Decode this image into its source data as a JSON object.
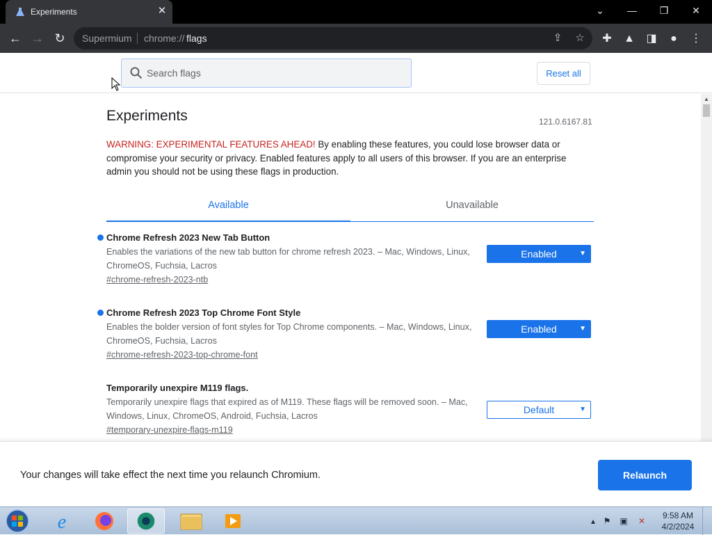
{
  "browser": {
    "tab_title": "Experiments",
    "tab_close": "✕",
    "window_controls": {
      "dropdown": "⌄",
      "minimize": "—",
      "restore": "❐",
      "close": "✕"
    },
    "omnibox": {
      "scheme_label": "Supermium",
      "url_prefix": "chrome://",
      "url_path": "flags"
    }
  },
  "flags_header": {
    "search_placeholder": "Search flags",
    "reset_all_label": "Reset all"
  },
  "page": {
    "title": "Experiments",
    "version": "121.0.6167.81",
    "warning_prefix": "WARNING: EXPERIMENTAL FEATURES AHEAD!",
    "warning_text": " By enabling these features, you could lose browser data or compromise your security or privacy. Enabled features apply to all users of this browser. If you are an enterprise admin you should not be using these flags in production.",
    "tabs": [
      {
        "label": "Available",
        "selected": true
      },
      {
        "label": "Unavailable",
        "selected": false
      }
    ],
    "flags": [
      {
        "name": "Chrome Refresh 2023 New Tab Button",
        "description": "Enables the variations of the new tab button for chrome refresh 2023. – Mac, Windows, Linux, ChromeOS, Fuchsia, Lacros",
        "link": "#chrome-refresh-2023-ntb",
        "value": "Enabled",
        "modified": true
      },
      {
        "name": "Chrome Refresh 2023 Top Chrome Font Style",
        "description": "Enables the bolder version of font styles for Top Chrome components. – Mac, Windows, Linux, ChromeOS, Fuchsia, Lacros",
        "link": "#chrome-refresh-2023-top-chrome-font",
        "value": "Enabled",
        "modified": true
      },
      {
        "name": "Temporarily unexpire M119 flags.",
        "description": "Temporarily unexpire flags that expired as of M119. These flags will be removed soon. – Mac, Windows, Linux, ChromeOS, Android, Fuchsia, Lacros",
        "link": "#temporary-unexpire-flags-m119",
        "value": "Default",
        "modified": false
      }
    ]
  },
  "footer": {
    "message": "Your changes will take effect the next time you relaunch Chromium.",
    "relaunch_label": "Relaunch"
  },
  "taskbar": {
    "apps": [
      "start-orb",
      "internet-explorer",
      "firefox",
      "supermium",
      "file-explorer",
      "media-player"
    ],
    "clock_time": "9:58 AM",
    "clock_date": "4/2/2024"
  },
  "colors": {
    "accent": "#1a73e8",
    "warning": "#c5221f",
    "toolbar": "#35363a",
    "titlebar": "#000000"
  }
}
